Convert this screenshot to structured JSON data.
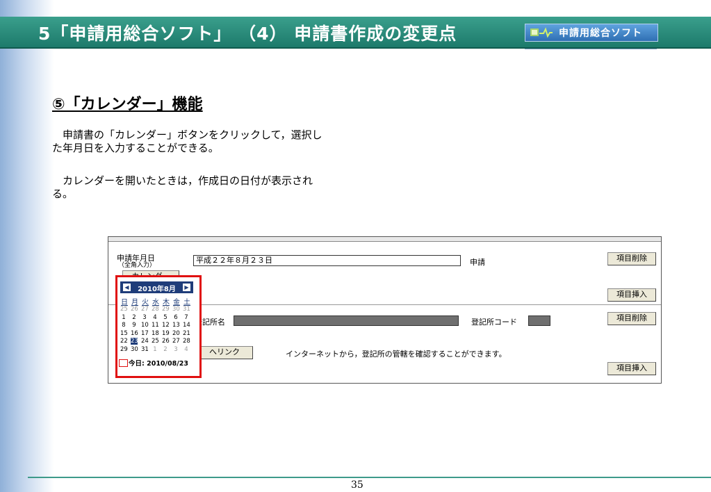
{
  "header": {
    "title": "5「申請用総合ソフト」 （4） 申請書作成の変更点",
    "badge": "申請用総合ソフト"
  },
  "section": {
    "heading": "⑤「カレンダー」機能",
    "paragraph1": "申請書の「カレンダー」ボタンをクリックして，選択した年月日を入力することができる。",
    "paragraph2": "カレンダーを開いたときは，作成日の日付が表示される。"
  },
  "form": {
    "date_label_line1": "申請年月日",
    "date_label_line2": "（全角入力）",
    "date_value": "平成２２年８月２３日",
    "apply_label": "申請",
    "calendar_button": "カレンダー",
    "delete_button_1": "項目削除",
    "insert_button_1": "項目挿入",
    "registry_name_label": "登記所名",
    "registry_code_label": "登記所コード",
    "delete_button_2": "項目削除",
    "link_button": "へリンク",
    "link_note": "インターネットから，登記所の管轄を確認することができます。",
    "insert_button_2": "項目挿入"
  },
  "calendar": {
    "month_title": "2010年8月",
    "weekdays": [
      "日",
      "月",
      "火",
      "水",
      "木",
      "金",
      "土"
    ],
    "weeks": [
      [
        "25",
        "26",
        "27",
        "28",
        "29",
        "30",
        "31"
      ],
      [
        "1",
        "2",
        "3",
        "4",
        "5",
        "6",
        "7"
      ],
      [
        "8",
        "9",
        "10",
        "11",
        "12",
        "13",
        "14"
      ],
      [
        "15",
        "16",
        "17",
        "18",
        "19",
        "20",
        "21"
      ],
      [
        "22",
        "23",
        "24",
        "25",
        "26",
        "27",
        "28"
      ],
      [
        "29",
        "30",
        "31",
        "1",
        "2",
        "3",
        "4"
      ]
    ],
    "today_label": "今日: 2010/08/23"
  },
  "footer": {
    "page_number": "35"
  }
}
